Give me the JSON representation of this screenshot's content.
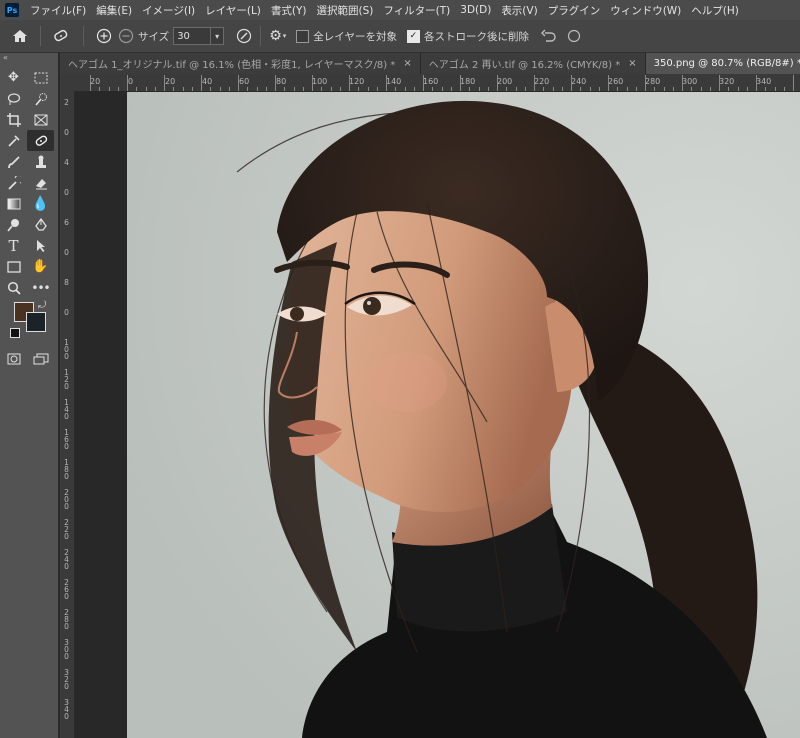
{
  "app": {
    "logo": "Ps"
  },
  "menu": [
    "ファイル(F)",
    "編集(E)",
    "イメージ(I)",
    "レイヤー(L)",
    "書式(Y)",
    "選択範囲(S)",
    "フィルター(T)",
    "3D(D)",
    "表示(V)",
    "プラグイン",
    "ウィンドウ(W)",
    "ヘルプ(H)"
  ],
  "options": {
    "size_label": "サイズ",
    "size_value": "30",
    "all_layers_label": "全レイヤーを対象",
    "all_layers_checked": false,
    "delete_stroke_label": "各ストローク後に削除",
    "delete_stroke_checked": true
  },
  "tabs": [
    {
      "label": "ヘアゴム 1_オリジナル.tif @ 16.1% (色相・彩度1, レイヤーマスク/8) *",
      "active": false
    },
    {
      "label": "ヘアゴム 2 再い.tif @ 16.2% (CMYK/8) *",
      "active": false
    },
    {
      "label": "350.png @ 80.7% (RGB/8#) *",
      "active": true
    }
  ],
  "tab_close": "×",
  "ruler_top_labels": [
    "20",
    "0",
    "20",
    "40",
    "60",
    "80",
    "100",
    "120",
    "140",
    "160",
    "180",
    "200",
    "220",
    "240",
    "260",
    "280",
    "300",
    "320",
    "340"
  ],
  "ruler_left_labels": [
    "2",
    "0",
    "4",
    "0",
    "6",
    "0",
    "8",
    "0",
    "1 0 0",
    "1 2 0",
    "1 4 0",
    "1 6 0",
    "1 8 0",
    "2 0 0",
    "2 2 0",
    "2 4 0",
    "2 6 0",
    "2 8 0",
    "3 0 0",
    "3 2 0",
    "3 4 0"
  ],
  "colors": {
    "foreground": "#4a3222",
    "background": "#1b2228",
    "canvas_bg": "#c7cbc7"
  },
  "toolbar_icons": [
    [
      "move-icon",
      "marquee-icon"
    ],
    [
      "lasso-icon",
      "quick-select-icon"
    ],
    [
      "crop-icon",
      "frame-icon"
    ],
    [
      "eyedropper-icon",
      "remove-tool-icon"
    ],
    [
      "brush-icon",
      "stamp-icon"
    ],
    [
      "history-brush-icon",
      "eraser-icon"
    ],
    [
      "gradient-icon",
      "blur-icon"
    ],
    [
      "dodge-icon",
      "pen-icon"
    ],
    [
      "type-icon",
      "path-select-icon"
    ],
    [
      "rectangle-icon",
      "hand-icon"
    ],
    [
      "zoom-icon",
      "more-tools-icon"
    ]
  ]
}
